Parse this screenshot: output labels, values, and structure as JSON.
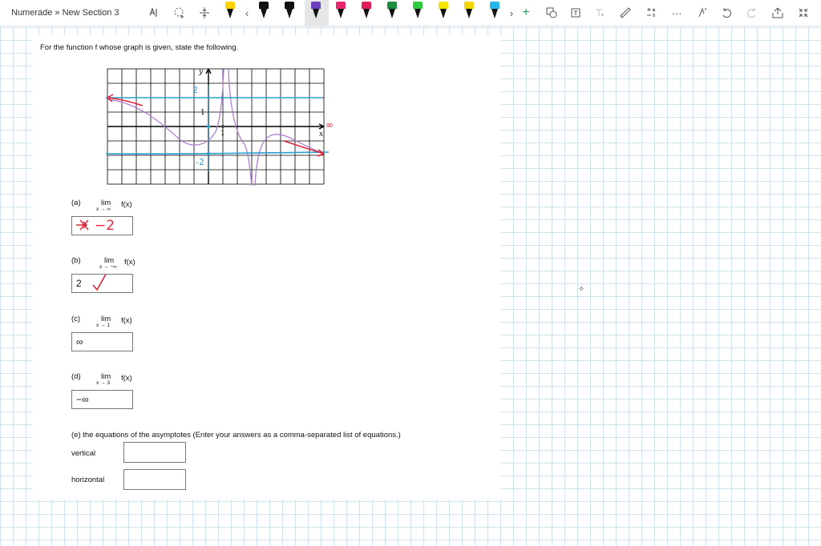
{
  "breadcrumb": "Numerade » New Section 3",
  "toolbar": {
    "pen_colors": [
      "#111111",
      "#1a1a1a",
      "#222222",
      "#333333",
      "#6a3fbf",
      "#e01e5a",
      "#e8256f",
      "#1e8e3e",
      "#2ecc40",
      "#f2e600",
      "#f2d600",
      "#25b7e8",
      "#9b59b6"
    ],
    "icons": [
      "lasso-icon",
      "add-space-icon",
      "insert-space-icon",
      "chevron-left-icon",
      "chevron-right-icon",
      "add-pen-icon",
      "ink-to-shape-icon",
      "ink-to-text-icon",
      "ink-to-math-icon",
      "ruler-icon",
      "math-icon",
      "more-icon",
      "replay-icon",
      "undo-icon",
      "redo-icon",
      "share-icon",
      "collapse-icon"
    ]
  },
  "question": {
    "prompt": "For the function f whose graph is given, state the following.",
    "parts": [
      {
        "label": "(a)",
        "lim": "lim",
        "sub": "x → ∞",
        "fx": "f(x)",
        "answer": "−2"
      },
      {
        "label": "(b)",
        "lim": "lim",
        "sub": "x → −∞",
        "fx": "f(x)",
        "answer": "2"
      },
      {
        "label": "(c)",
        "lim": "lim",
        "sub": "x → 1",
        "fx": "f(x)",
        "answer": "∞"
      },
      {
        "label": "(d)",
        "lim": "lim",
        "sub": "x → 3",
        "fx": "f(x)",
        "answer": "−∞"
      }
    ],
    "part_e": "(e)  the equations of the asymptotes (Enter your answers as a comma-separated list of equations.)",
    "vertical_label": "vertical",
    "horizontal_label": "horizontal",
    "vertical_value": "",
    "horizontal_value": ""
  },
  "graph": {
    "y_axis_label": "y",
    "x_axis_label": "x",
    "tick_1_x": "1",
    "tick_1_y": "1",
    "ink_2": "2",
    "ink_neg2": "-2",
    "ink_infinity": "∞"
  },
  "ink": {
    "blue": "#2a9fd0",
    "red": "#e0253a",
    "purple": "#b07fd0"
  }
}
